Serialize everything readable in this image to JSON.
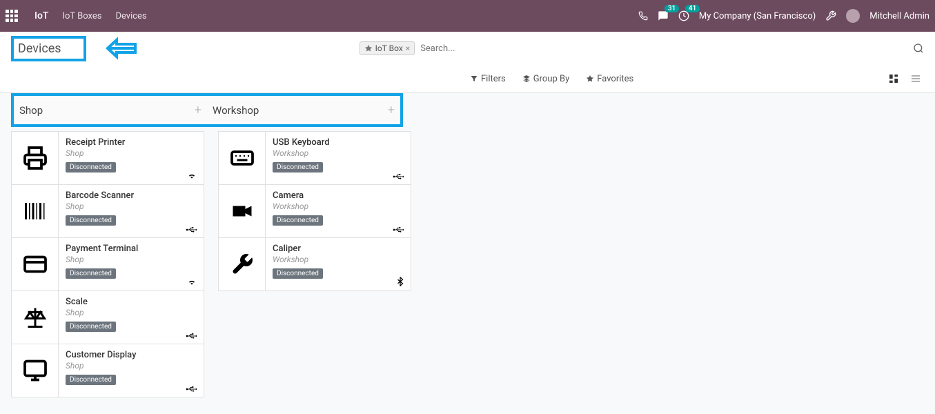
{
  "topbar": {
    "app_name": "IoT",
    "nav": [
      "IoT Boxes",
      "Devices"
    ],
    "messages_badge": "31",
    "activities_badge": "41",
    "company": "My Company (San Francisco)",
    "user": "Mitchell Admin"
  },
  "breadcrumb": {
    "title": "Devices"
  },
  "search": {
    "facet_label": "IoT Box",
    "placeholder": "Search..."
  },
  "filters": {
    "filters": "Filters",
    "groupby": "Group By",
    "favorites": "Favorites"
  },
  "columns": [
    {
      "title": "Shop"
    },
    {
      "title": "Workshop"
    }
  ],
  "cards_shop": [
    {
      "title": "Receipt Printer",
      "sub": "Shop",
      "status": "Disconnected",
      "icon": "printer",
      "conn": "wifi"
    },
    {
      "title": "Barcode Scanner",
      "sub": "Shop",
      "status": "Disconnected",
      "icon": "barcode",
      "conn": "usb"
    },
    {
      "title": "Payment Terminal",
      "sub": "Shop",
      "status": "Disconnected",
      "icon": "card",
      "conn": "wifi"
    },
    {
      "title": "Scale",
      "sub": "Shop",
      "status": "Disconnected",
      "icon": "scale",
      "conn": "usb"
    },
    {
      "title": "Customer Display",
      "sub": "Shop",
      "status": "Disconnected",
      "icon": "monitor",
      "conn": "usb"
    }
  ],
  "cards_workshop": [
    {
      "title": "USB Keyboard",
      "sub": "Workshop",
      "status": "Disconnected",
      "icon": "keyboard",
      "conn": "usb"
    },
    {
      "title": "Camera",
      "sub": "Workshop",
      "status": "Disconnected",
      "icon": "camera",
      "conn": "usb"
    },
    {
      "title": "Caliper",
      "sub": "Workshop",
      "status": "Disconnected",
      "icon": "wrench",
      "conn": "bluetooth"
    }
  ]
}
